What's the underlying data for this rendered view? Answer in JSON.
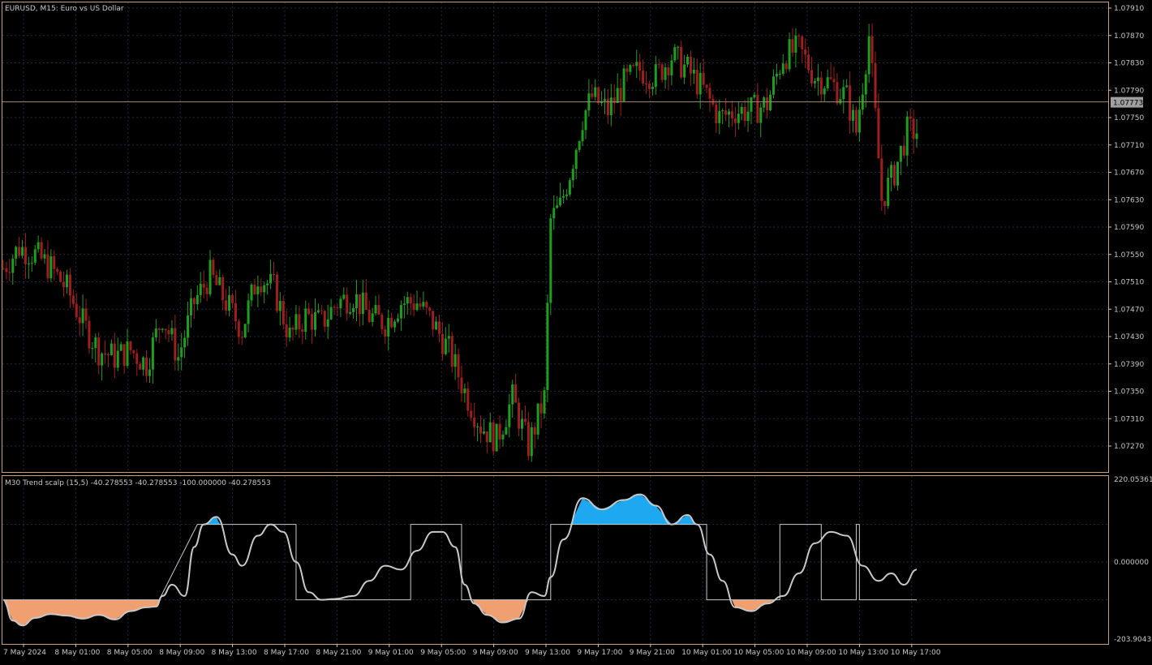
{
  "chart_header": {
    "symbol_title": "EURUSD, M15:  Euro vs US Dollar",
    "indicator_title": "M30 Trend scalp (15,5) -40.278553 -40.278553 -100.000000 -40.278553"
  },
  "price_axis": {
    "ticks": [
      "1.07910",
      "1.07870",
      "1.07830",
      "1.07790",
      "1.07750",
      "1.07710",
      "1.07670",
      "1.07630",
      "1.07590",
      "1.07550",
      "1.07510",
      "1.07470",
      "1.07430",
      "1.07390",
      "1.07350",
      "1.07310",
      "1.07270"
    ],
    "current_price_label": "1.07773"
  },
  "indicator_axis": {
    "ticks": [
      "220.053616",
      "0.000000",
      "-203.904326"
    ]
  },
  "time_axis": {
    "ticks": [
      "7 May 2024",
      "8 May 01:00",
      "8 May 05:00",
      "8 May 09:00",
      "8 May 13:00",
      "8 May 17:00",
      "8 May 21:00",
      "9 May 01:00",
      "9 May 05:00",
      "9 May 09:00",
      "9 May 13:00",
      "9 May 17:00",
      "9 May 21:00",
      "10 May 01:00",
      "10 May 05:00",
      "10 May 09:00",
      "10 May 13:00",
      "10 May 17:00"
    ]
  },
  "colors": {
    "background": "#000000",
    "frame": "#c8a078",
    "grid": "#1e2a44",
    "bull_candle": "#1e9e1e",
    "bear_candle": "#a01e1e",
    "indicator_line": "#c8c8c8",
    "indicator_up_fill": "#1ea8f0",
    "indicator_down_fill": "#f0a070",
    "indicator_down_edge": "#ff5a1e",
    "axis_text": "#c8c8c8",
    "price_marker_bg": "#a0a0a0"
  },
  "chart_data": [
    {
      "type": "candlestick",
      "title": "EURUSD, M15:  Euro vs US Dollar",
      "ylim": [
        1.0725,
        1.0793
      ],
      "current_price": 1.07773,
      "x_labels": [
        "7 May 2024",
        "8 May 01:00",
        "8 May 05:00",
        "8 May 09:00",
        "8 May 13:00",
        "8 May 17:00",
        "8 May 21:00",
        "9 May 01:00",
        "9 May 05:00",
        "9 May 09:00",
        "9 May 13:00",
        "9 May 17:00",
        "9 May 21:00",
        "10 May 01:00",
        "10 May 05:00",
        "10 May 09:00",
        "10 May 13:00",
        "10 May 17:00"
      ],
      "close_path": [
        [
          0,
          1.0753
        ],
        [
          5,
          1.0756
        ],
        [
          10,
          1.0755
        ],
        [
          15,
          1.0753
        ],
        [
          20,
          1.075
        ],
        [
          25,
          1.0745
        ],
        [
          30,
          1.0741
        ],
        [
          35,
          1.074
        ],
        [
          40,
          1.0741
        ],
        [
          45,
          1.0739
        ],
        [
          50,
          1.0746
        ],
        [
          55,
          1.074
        ],
        [
          60,
          1.0748
        ],
        [
          65,
          1.0752
        ],
        [
          70,
          1.0748
        ],
        [
          75,
          1.0744
        ],
        [
          80,
          1.0752
        ],
        [
          85,
          1.075
        ],
        [
          90,
          1.0743
        ],
        [
          95,
          1.0746
        ],
        [
          100,
          1.0745
        ],
        [
          105,
          1.0748
        ],
        [
          110,
          1.0749
        ],
        [
          115,
          1.0746
        ],
        [
          120,
          1.0745
        ],
        [
          125,
          1.0748
        ],
        [
          130,
          1.0748
        ],
        [
          135,
          1.0745
        ],
        [
          140,
          1.0741
        ],
        [
          145,
          1.0735
        ],
        [
          150,
          1.073
        ],
        [
          155,
          1.0728
        ],
        [
          160,
          1.0734
        ],
        [
          165,
          1.0727
        ],
        [
          170,
          1.0734
        ],
        [
          172,
          1.076
        ],
        [
          175,
          1.0762
        ],
        [
          178,
          1.0767
        ],
        [
          182,
          1.0775
        ],
        [
          185,
          1.0778
        ],
        [
          190,
          1.0776
        ],
        [
          195,
          1.078
        ],
        [
          200,
          1.0782
        ],
        [
          205,
          1.0781
        ],
        [
          210,
          1.0784
        ],
        [
          215,
          1.0782
        ],
        [
          220,
          1.0779
        ],
        [
          225,
          1.0775
        ],
        [
          230,
          1.0776
        ],
        [
          235,
          1.0776
        ],
        [
          240,
          1.0777
        ],
        [
          245,
          1.0784
        ],
        [
          250,
          1.0785
        ],
        [
          255,
          1.0781
        ],
        [
          260,
          1.078
        ],
        [
          265,
          1.0778
        ],
        [
          268,
          1.0773
        ],
        [
          272,
          1.0787
        ],
        [
          276,
          1.0763
        ],
        [
          280,
          1.0767
        ],
        [
          284,
          1.0773
        ]
      ]
    },
    {
      "type": "line",
      "title": "M30 Trend scalp (15,5) -40.278553 -40.278553 -100.000000 -40.278553",
      "ylim": [
        -203.904326,
        220.053616
      ],
      "step_levels": {
        "high": 100,
        "low": -100
      },
      "series": [
        {
          "name": "Trend scalp",
          "points": [
            [
              0,
              -100
            ],
            [
              3,
              -155
            ],
            [
              6,
              -168
            ],
            [
              10,
              -148
            ],
            [
              15,
              -138
            ],
            [
              20,
              -142
            ],
            [
              25,
              -150
            ],
            [
              30,
              -140
            ],
            [
              35,
              -152
            ],
            [
              40,
              -130
            ],
            [
              45,
              -120
            ],
            [
              48,
              -118
            ],
            [
              50,
              -90
            ],
            [
              53,
              -60
            ],
            [
              57,
              -90
            ],
            [
              60,
              40
            ],
            [
              63,
              100
            ],
            [
              67,
              120
            ],
            [
              72,
              20
            ],
            [
              75,
              -10
            ],
            [
              80,
              70
            ],
            [
              84,
              100
            ],
            [
              88,
              80
            ],
            [
              92,
              0
            ],
            [
              96,
              -80
            ],
            [
              100,
              -100
            ],
            [
              104,
              -98
            ],
            [
              110,
              -90
            ],
            [
              115,
              -50
            ],
            [
              120,
              -10
            ],
            [
              125,
              -20
            ],
            [
              130,
              30
            ],
            [
              135,
              80
            ],
            [
              138,
              80
            ],
            [
              142,
              40
            ],
            [
              145,
              -60
            ],
            [
              148,
              -110
            ],
            [
              152,
              -140
            ],
            [
              157,
              -160
            ],
            [
              162,
              -150
            ],
            [
              166,
              -80
            ],
            [
              170,
              -90
            ],
            [
              172,
              -40
            ],
            [
              176,
              60
            ],
            [
              182,
              170
            ],
            [
              188,
              140
            ],
            [
              195,
              165
            ],
            [
              200,
              180
            ],
            [
              205,
              150
            ],
            [
              210,
              100
            ],
            [
              215,
              125
            ],
            [
              218,
              100
            ],
            [
              222,
              20
            ],
            [
              226,
              -50
            ],
            [
              230,
              -120
            ],
            [
              235,
              -130
            ],
            [
              240,
              -110
            ],
            [
              245,
              -90
            ],
            [
              250,
              -30
            ],
            [
              255,
              50
            ],
            [
              260,
              80
            ],
            [
              265,
              70
            ],
            [
              270,
              -10
            ],
            [
              275,
              -50
            ],
            [
              279,
              -30
            ],
            [
              283,
              -60
            ],
            [
              287,
              -20
            ]
          ]
        }
      ],
      "step_series": {
        "name": "state",
        "points": [
          [
            0,
            -100
          ],
          [
            49,
            -100
          ],
          [
            61,
            100
          ],
          [
            92,
            100
          ],
          [
            92,
            -100
          ],
          [
            128,
            -100
          ],
          [
            128,
            100
          ],
          [
            144,
            100
          ],
          [
            144,
            -100
          ],
          [
            172,
            -100
          ],
          [
            172,
            100
          ],
          [
            221,
            100
          ],
          [
            221,
            -100
          ],
          [
            244,
            -100
          ],
          [
            244,
            100
          ],
          [
            257,
            100
          ],
          [
            257,
            -100
          ],
          [
            268,
            -100
          ],
          [
            268,
            100
          ],
          [
            269,
            100
          ],
          [
            269,
            -100
          ],
          [
            287,
            -100
          ]
        ]
      }
    }
  ]
}
